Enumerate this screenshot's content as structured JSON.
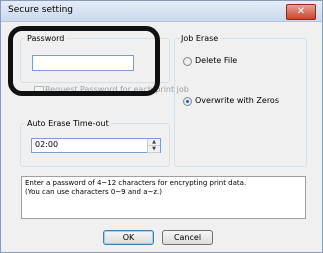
{
  "window": {
    "title": "Secure setting",
    "close_symbol": "✕"
  },
  "password_group": {
    "legend": "Password",
    "value": "",
    "request_each_job_label": "Request Password for each print job",
    "request_each_job_checked": false,
    "request_each_job_enabled": false
  },
  "auto_erase": {
    "legend": "Auto Erase Time-out",
    "value": "02:00"
  },
  "job_erase": {
    "legend": "Job Erase",
    "options": [
      {
        "label": "Delete File",
        "selected": false
      },
      {
        "label": "Overwrite with Zeros",
        "selected": true
      }
    ]
  },
  "info": {
    "line1": "Enter a password of 4~12 characters for encrypting print data.",
    "line2": "(You can use characters 0~9 and  a~z.)"
  },
  "buttons": {
    "ok": "OK",
    "cancel": "Cancel"
  },
  "colors": {
    "title_bar": "#cbd9ec",
    "close_button": "#c9452e",
    "annotation_outline": "#111111"
  }
}
